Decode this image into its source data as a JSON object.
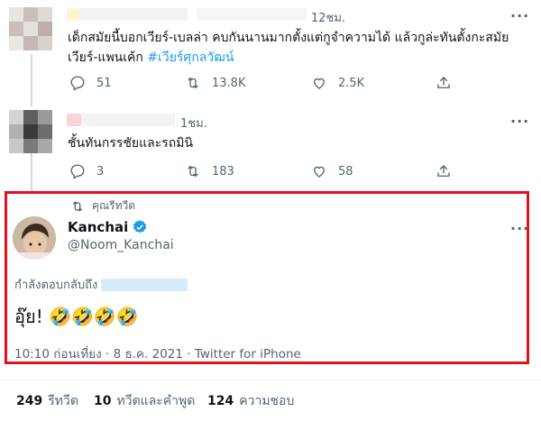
{
  "tweet1": {
    "time": "12ชม.",
    "text_plain": "เด็กสมัยนี้บอกเวียร์-เบลล่า คบกันนานมากตั้งแต่กูจำความได้ แล้วกูล่ะทันตั้งกะสมัยเวียร์-แพนเค้ก ",
    "hashtag": "#เวียร์ศุกลวัฒน์",
    "replies": "51",
    "retweets": "13.8K",
    "likes": "2.5K"
  },
  "tweet2": {
    "time": "1ชม.",
    "text": "ชั้นทันกรรชัยและรถมินิ",
    "replies": "3",
    "retweets": "183",
    "likes": "58"
  },
  "main_tweet": {
    "retweeted_label": "คุณรีทวีต",
    "display_name": "Kanchai",
    "handle": "@Noom_Kanchai",
    "replying_to": "กำลังตอบกลับถึง",
    "text": "อุ๊ย! 🤣🤣🤣🤣",
    "meta": "10:10 ก่อนเที่ยง · 8 ธ.ค. 2021 · Twitter for iPhone"
  },
  "stats": {
    "retweets_count": "249",
    "retweets_label": "รีทวีต",
    "quotes_count": "10",
    "quotes_label": "ทวีตและคำพูด",
    "likes_count": "124",
    "likes_label": "ความชอบ"
  },
  "colors": {
    "accent": "#1d9bf0",
    "highlight": "#e3101d",
    "muted": "#536471"
  }
}
